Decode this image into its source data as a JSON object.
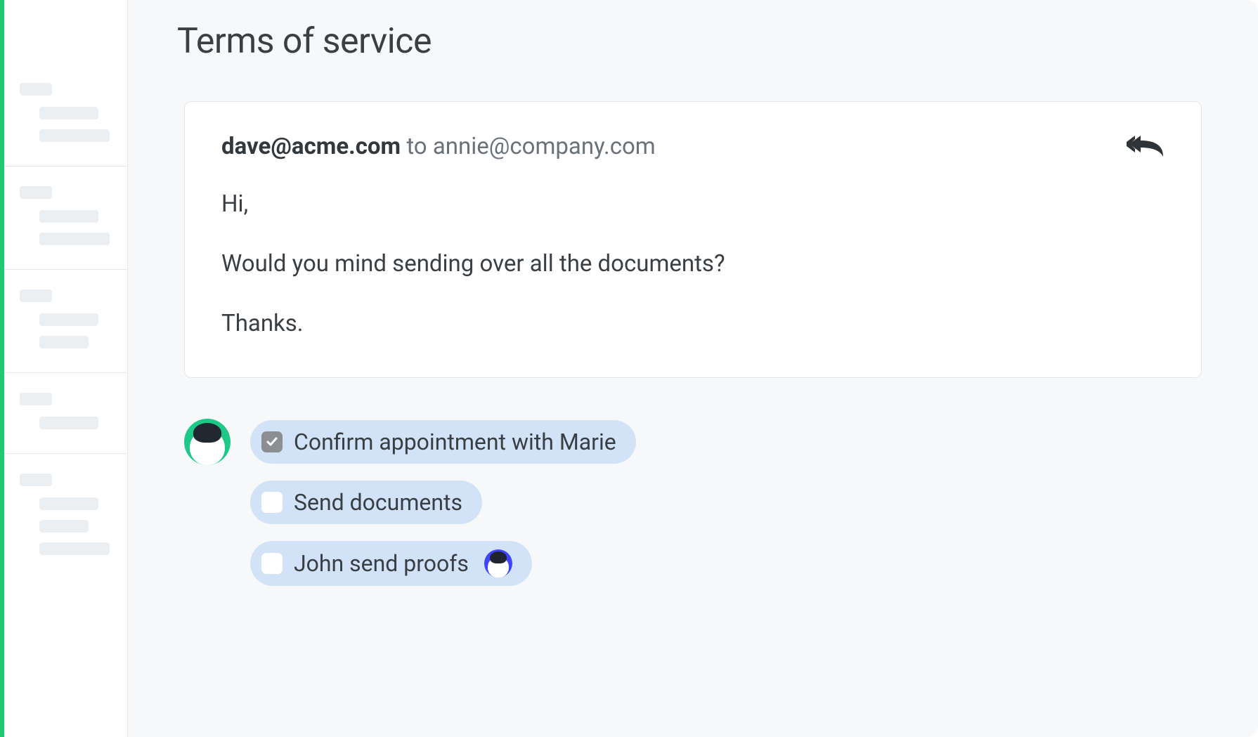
{
  "page": {
    "title": "Terms of service"
  },
  "email": {
    "from": "dave@acme.com",
    "to_prefix": " to ",
    "to": "annie@company.com",
    "body": {
      "greeting": "Hi,",
      "line1": "Would you mind sending over all the documents?",
      "signoff": "Thanks."
    }
  },
  "tasks": [
    {
      "label": "Confirm appointment with Marie",
      "checked": true,
      "assignee": null
    },
    {
      "label": "Send documents",
      "checked": false,
      "assignee": null
    },
    {
      "label": "John send proofs",
      "checked": false,
      "assignee": "john"
    }
  ],
  "icons": {
    "reply_all": "reply-all-icon"
  },
  "colors": {
    "accent_green": "#1ec988",
    "pill_blue": "#d2e3f7",
    "assignee_blue": "#3f45ff",
    "text_dark": "#33383d"
  }
}
